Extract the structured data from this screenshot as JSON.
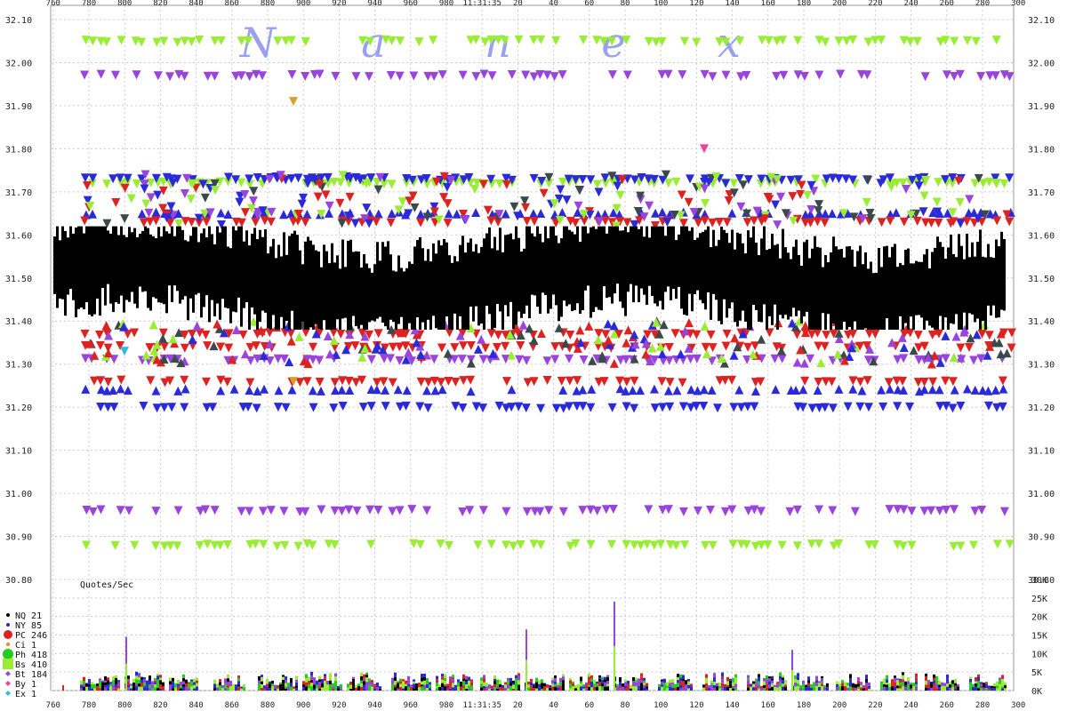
{
  "watermark": [
    "N",
    "a",
    "n",
    "e",
    "x"
  ],
  "colors": {
    "NQ": "#000000",
    "NY": "#2a2ad8",
    "PC": "#dd2222",
    "Ci": "#e88a2a",
    "Ph": "#22cc22",
    "Bs": "#99ee33",
    "Bt": "#9944dd",
    "By": "#e8469a",
    "Ex": "#33bbdd",
    "bar": "#000000",
    "grid": "#cccccc",
    "dark": "#3a4a4a",
    "gold": "#d4a030"
  },
  "chart_data": [
    {
      "type": "scatter",
      "title": "",
      "x_time_label": "11:31:35",
      "x_ticks": [
        "760",
        "780",
        "800",
        "820",
        "840",
        "860",
        "880",
        "900",
        "920",
        "940",
        "960",
        "980",
        "11:31:35",
        "20",
        "40",
        "60",
        "80",
        "100",
        "120",
        "140",
        "160",
        "180",
        "200",
        "220",
        "240",
        "260",
        "280",
        "300"
      ],
      "y_ticks": [
        "32.10",
        "32.00",
        "31.90",
        "31.80",
        "31.70",
        "31.60",
        "31.50",
        "31.40",
        "31.30",
        "31.20",
        "31.10",
        "31.00",
        "30.90",
        "30.80"
      ],
      "ylim": [
        30.8,
        32.1
      ],
      "grid": true,
      "series": [
        {
          "name": "Bs",
          "shape": "down-triangle",
          "color": "#99ee33",
          "levels": [
            32.05,
            31.72,
            30.88
          ]
        },
        {
          "name": "Bt",
          "shape": "down-triangle",
          "color": "#9944dd",
          "levels": [
            31.97,
            31.31,
            30.96
          ]
        },
        {
          "name": "NY",
          "shape": "down-triangle",
          "color": "#2a2ad8",
          "levels": [
            31.73,
            31.65,
            31.2,
            31.24
          ]
        },
        {
          "name": "PC",
          "shape": "down-triangle",
          "color": "#dd2222",
          "levels": [
            31.63,
            31.26,
            31.34,
            31.37
          ]
        },
        {
          "name": "NQ",
          "shape": "bar",
          "color": "#000000",
          "range": [
            31.38,
            31.62
          ]
        }
      ]
    },
    {
      "type": "bar",
      "title": "Quotes/Sec",
      "y_ticks": [
        "30K",
        "25K",
        "20K",
        "15K",
        "10K",
        "5K",
        "0K"
      ],
      "ylim": [
        0,
        30000
      ],
      "spikes": [
        {
          "x": "800",
          "value": 14500
        },
        {
          "x": "25",
          "value": 16500
        },
        {
          "x": "75",
          "value": 24000
        },
        {
          "x": "175",
          "value": 11000
        }
      ]
    }
  ],
  "legend": [
    {
      "code": "NQ",
      "count": "21"
    },
    {
      "code": "NY",
      "count": "85"
    },
    {
      "code": "PC",
      "count": "246"
    },
    {
      "code": "Ci",
      "count": "1"
    },
    {
      "code": "Ph",
      "count": "418"
    },
    {
      "code": "Bs",
      "count": "410"
    },
    {
      "code": "Bt",
      "count": "184"
    },
    {
      "code": "By",
      "count": "1"
    },
    {
      "code": "Ex",
      "count": "1"
    }
  ]
}
